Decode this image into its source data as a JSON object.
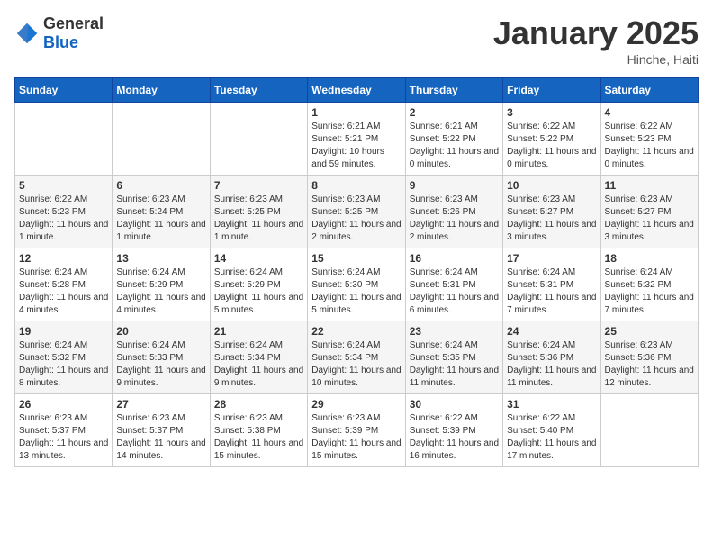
{
  "header": {
    "logo_general": "General",
    "logo_blue": "Blue",
    "month": "January 2025",
    "location": "Hinche, Haiti"
  },
  "weekdays": [
    "Sunday",
    "Monday",
    "Tuesday",
    "Wednesday",
    "Thursday",
    "Friday",
    "Saturday"
  ],
  "weeks": [
    [
      {
        "day": "",
        "info": ""
      },
      {
        "day": "",
        "info": ""
      },
      {
        "day": "",
        "info": ""
      },
      {
        "day": "1",
        "info": "Sunrise: 6:21 AM\nSunset: 5:21 PM\nDaylight: 10 hours and 59 minutes."
      },
      {
        "day": "2",
        "info": "Sunrise: 6:21 AM\nSunset: 5:22 PM\nDaylight: 11 hours and 0 minutes."
      },
      {
        "day": "3",
        "info": "Sunrise: 6:22 AM\nSunset: 5:22 PM\nDaylight: 11 hours and 0 minutes."
      },
      {
        "day": "4",
        "info": "Sunrise: 6:22 AM\nSunset: 5:23 PM\nDaylight: 11 hours and 0 minutes."
      }
    ],
    [
      {
        "day": "5",
        "info": "Sunrise: 6:22 AM\nSunset: 5:23 PM\nDaylight: 11 hours and 1 minute."
      },
      {
        "day": "6",
        "info": "Sunrise: 6:23 AM\nSunset: 5:24 PM\nDaylight: 11 hours and 1 minute."
      },
      {
        "day": "7",
        "info": "Sunrise: 6:23 AM\nSunset: 5:25 PM\nDaylight: 11 hours and 1 minute."
      },
      {
        "day": "8",
        "info": "Sunrise: 6:23 AM\nSunset: 5:25 PM\nDaylight: 11 hours and 2 minutes."
      },
      {
        "day": "9",
        "info": "Sunrise: 6:23 AM\nSunset: 5:26 PM\nDaylight: 11 hours and 2 minutes."
      },
      {
        "day": "10",
        "info": "Sunrise: 6:23 AM\nSunset: 5:27 PM\nDaylight: 11 hours and 3 minutes."
      },
      {
        "day": "11",
        "info": "Sunrise: 6:23 AM\nSunset: 5:27 PM\nDaylight: 11 hours and 3 minutes."
      }
    ],
    [
      {
        "day": "12",
        "info": "Sunrise: 6:24 AM\nSunset: 5:28 PM\nDaylight: 11 hours and 4 minutes."
      },
      {
        "day": "13",
        "info": "Sunrise: 6:24 AM\nSunset: 5:29 PM\nDaylight: 11 hours and 4 minutes."
      },
      {
        "day": "14",
        "info": "Sunrise: 6:24 AM\nSunset: 5:29 PM\nDaylight: 11 hours and 5 minutes."
      },
      {
        "day": "15",
        "info": "Sunrise: 6:24 AM\nSunset: 5:30 PM\nDaylight: 11 hours and 5 minutes."
      },
      {
        "day": "16",
        "info": "Sunrise: 6:24 AM\nSunset: 5:31 PM\nDaylight: 11 hours and 6 minutes."
      },
      {
        "day": "17",
        "info": "Sunrise: 6:24 AM\nSunset: 5:31 PM\nDaylight: 11 hours and 7 minutes."
      },
      {
        "day": "18",
        "info": "Sunrise: 6:24 AM\nSunset: 5:32 PM\nDaylight: 11 hours and 7 minutes."
      }
    ],
    [
      {
        "day": "19",
        "info": "Sunrise: 6:24 AM\nSunset: 5:32 PM\nDaylight: 11 hours and 8 minutes."
      },
      {
        "day": "20",
        "info": "Sunrise: 6:24 AM\nSunset: 5:33 PM\nDaylight: 11 hours and 9 minutes."
      },
      {
        "day": "21",
        "info": "Sunrise: 6:24 AM\nSunset: 5:34 PM\nDaylight: 11 hours and 9 minutes."
      },
      {
        "day": "22",
        "info": "Sunrise: 6:24 AM\nSunset: 5:34 PM\nDaylight: 11 hours and 10 minutes."
      },
      {
        "day": "23",
        "info": "Sunrise: 6:24 AM\nSunset: 5:35 PM\nDaylight: 11 hours and 11 minutes."
      },
      {
        "day": "24",
        "info": "Sunrise: 6:24 AM\nSunset: 5:36 PM\nDaylight: 11 hours and 11 minutes."
      },
      {
        "day": "25",
        "info": "Sunrise: 6:23 AM\nSunset: 5:36 PM\nDaylight: 11 hours and 12 minutes."
      }
    ],
    [
      {
        "day": "26",
        "info": "Sunrise: 6:23 AM\nSunset: 5:37 PM\nDaylight: 11 hours and 13 minutes."
      },
      {
        "day": "27",
        "info": "Sunrise: 6:23 AM\nSunset: 5:37 PM\nDaylight: 11 hours and 14 minutes."
      },
      {
        "day": "28",
        "info": "Sunrise: 6:23 AM\nSunset: 5:38 PM\nDaylight: 11 hours and 15 minutes."
      },
      {
        "day": "29",
        "info": "Sunrise: 6:23 AM\nSunset: 5:39 PM\nDaylight: 11 hours and 15 minutes."
      },
      {
        "day": "30",
        "info": "Sunrise: 6:22 AM\nSunset: 5:39 PM\nDaylight: 11 hours and 16 minutes."
      },
      {
        "day": "31",
        "info": "Sunrise: 6:22 AM\nSunset: 5:40 PM\nDaylight: 11 hours and 17 minutes."
      },
      {
        "day": "",
        "info": ""
      }
    ]
  ]
}
